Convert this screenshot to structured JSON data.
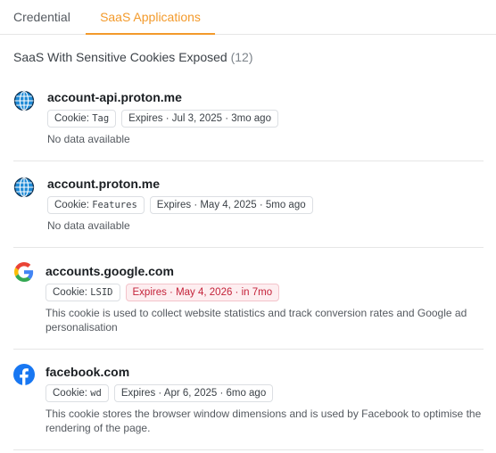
{
  "tabs": [
    {
      "label": "Credential"
    },
    {
      "label": "SaaS Applications"
    }
  ],
  "section": {
    "title": "SaaS With Sensitive Cookies Exposed",
    "count": "(12)"
  },
  "items": [
    {
      "icon": "globe-icon",
      "domain": "account-api.proton.me",
      "cookie_prefix": "Cookie:",
      "cookie_name": "Tag",
      "expires": "Expires · Jul 3, 2025 · 3mo ago",
      "description": "No data available"
    },
    {
      "icon": "globe-icon",
      "domain": "account.proton.me",
      "cookie_prefix": "Cookie:",
      "cookie_name": "Features",
      "expires": "Expires · May 4, 2025 · 5mo ago",
      "description": "No data available"
    },
    {
      "icon": "google-icon",
      "domain": "accounts.google.com",
      "cookie_prefix": "Cookie:",
      "cookie_name": "LSID",
      "expires": "Expires · May 4, 2026 · in 7mo",
      "description": "This cookie is used to collect website statistics and track conversion rates and Google ad personalisation"
    },
    {
      "icon": "facebook-icon",
      "domain": "facebook.com",
      "cookie_prefix": "Cookie:",
      "cookie_name": "wd",
      "expires": "Expires · Apr 6, 2025 · 6mo ago",
      "description": "This cookie stores the browser window dimensions and is used by Facebook to optimise the rendering of the page."
    }
  ],
  "colors": {
    "accent": "#f39a2b",
    "expired_badge_text": "#c4233a",
    "expired_badge_bg": "#fdeef0",
    "facebook_blue": "#1877f2",
    "globe_blue": "#1e8ad6"
  }
}
